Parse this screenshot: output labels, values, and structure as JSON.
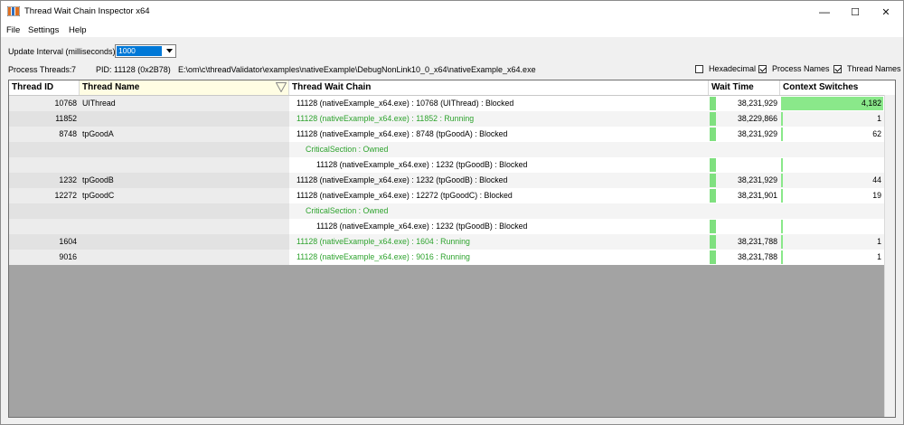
{
  "window": {
    "title": "Thread Wait Chain Inspector x64",
    "controls": {
      "minimize": "—",
      "maximize": "☐",
      "close": "✕"
    }
  },
  "menu": [
    "File",
    "Settings",
    "Help"
  ],
  "toolbar": {
    "interval_label": "Update Interval (milliseconds):",
    "interval_value": "1000"
  },
  "info": {
    "process_threads_label": "Process Threads:",
    "process_threads_value": "7",
    "pid": "PID: 11128 (0x2B78)",
    "path": "E:\\om\\c\\threadValidator\\examples\\nativeExample\\DebugNonLink10_0_x64\\nativeExample_x64.exe"
  },
  "options": [
    {
      "label": "Hexadecimal",
      "checked": false
    },
    {
      "label": "Process Names",
      "checked": true
    },
    {
      "label": "Thread Names",
      "checked": true
    }
  ],
  "columns": [
    "Thread ID",
    "Thread Name",
    "Thread Wait Chain",
    "Wait Time",
    "Context Switches"
  ],
  "rows": [
    {
      "id": "10768",
      "name": "UIThread",
      "chain": "11128 (nativeExample_x64.exe) : 10768 (UIThread) : Blocked",
      "status": "blocked",
      "wait": "38,231,929",
      "ctx": "4,182",
      "ctx_fraction": 1.0,
      "depth": 0
    },
    {
      "id": "11852",
      "name": "",
      "chain": "11128 (nativeExample_x64.exe) : 11852 : Running",
      "status": "running",
      "wait": "38,229,866",
      "ctx": "1",
      "ctx_fraction": 0,
      "depth": 0
    },
    {
      "id": "8748",
      "name": "tpGoodA",
      "chain": "11128 (nativeExample_x64.exe) : 8748 (tpGoodA) : Blocked",
      "status": "blocked",
      "wait": "38,231,929",
      "ctx": "62",
      "ctx_fraction": 0,
      "depth": 0
    },
    {
      "id": "",
      "name": "",
      "chain": "CriticalSection : Owned",
      "status": "running",
      "wait": "",
      "ctx": "",
      "ctx_fraction": 0,
      "depth": 1,
      "no_bars": true
    },
    {
      "id": "",
      "name": "",
      "chain": "11128 (nativeExample_x64.exe) : 1232 (tpGoodB) : Blocked",
      "status": "blocked",
      "wait": "",
      "ctx": "",
      "ctx_fraction": 0,
      "depth": 2
    },
    {
      "id": "1232",
      "name": "tpGoodB",
      "chain": "11128 (nativeExample_x64.exe) : 1232 (tpGoodB) : Blocked",
      "status": "blocked",
      "wait": "38,231,929",
      "ctx": "44",
      "ctx_fraction": 0,
      "depth": 0
    },
    {
      "id": "12272",
      "name": "tpGoodC",
      "chain": "11128 (nativeExample_x64.exe) : 12272 (tpGoodC) : Blocked",
      "status": "blocked",
      "wait": "38,231,901",
      "ctx": "19",
      "ctx_fraction": 0,
      "depth": 0
    },
    {
      "id": "",
      "name": "",
      "chain": "CriticalSection : Owned",
      "status": "running",
      "wait": "",
      "ctx": "",
      "ctx_fraction": 0,
      "depth": 1,
      "no_bars": true
    },
    {
      "id": "",
      "name": "",
      "chain": "11128 (nativeExample_x64.exe) : 1232 (tpGoodB) : Blocked",
      "status": "blocked",
      "wait": "",
      "ctx": "",
      "ctx_fraction": 0,
      "depth": 2
    },
    {
      "id": "1604",
      "name": "",
      "chain": "11128 (nativeExample_x64.exe) : 1604 : Running",
      "status": "running",
      "wait": "38,231,788",
      "ctx": "1",
      "ctx_fraction": 0,
      "depth": 0
    },
    {
      "id": "9016",
      "name": "",
      "chain": "11128 (nativeExample_x64.exe) : 9016 : Running",
      "status": "running",
      "wait": "38,231,788",
      "ctx": "1",
      "ctx_fraction": 0,
      "depth": 0
    }
  ],
  "colors": {
    "running": "#2ea32e",
    "bar": "#7fe07f",
    "selection": "#0078d7"
  }
}
